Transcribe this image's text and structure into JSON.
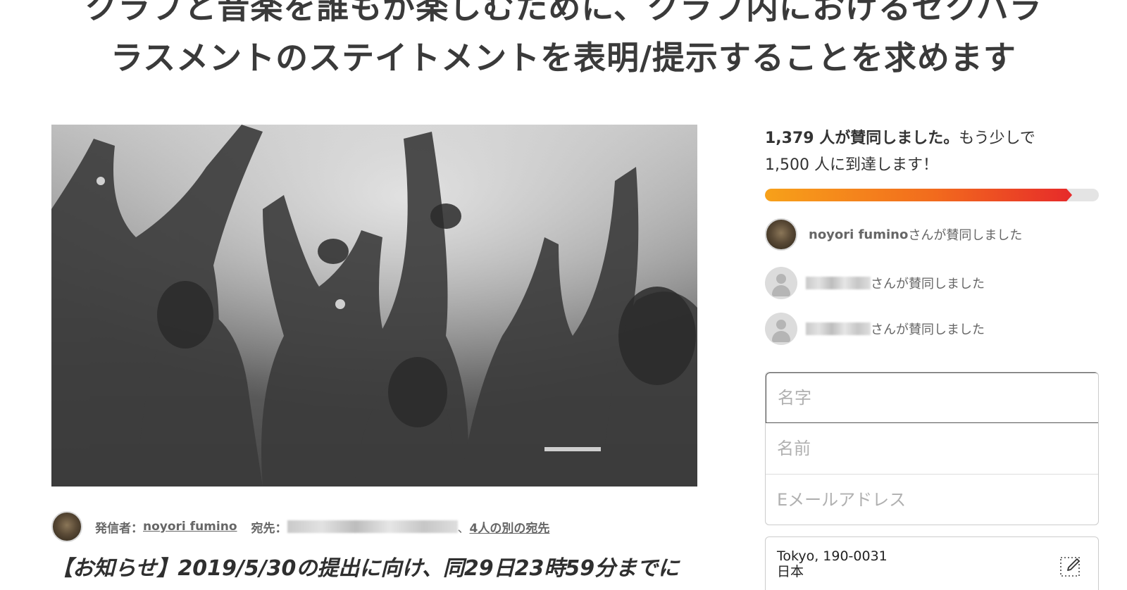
{
  "petition": {
    "title_line1": "クラブと音楽を誰もが楽しむために、クラブ内におけるセクハラ",
    "title_line2": "ラスメントのステイトメントを表明/提示することを求めます"
  },
  "author": {
    "sender_label": "発信者：",
    "sender_name": "noyori fumino",
    "recipient_label": "宛先：",
    "recipient_separator": "、",
    "other_recipients_link": "4人の別の宛先"
  },
  "announcement": "【お知らせ】2019/5/30の提出に向け、同29日23時59分までに",
  "progress": {
    "count_bold": "1,379 人が賛同しました。",
    "count_rest": "もう少しで",
    "goal_text": "1,500 人に到達します！",
    "fraction": 0.92,
    "colors": {
      "start": "#f7a11a",
      "end": "#e62a2a",
      "track": "#e4e4e4"
    }
  },
  "signers": [
    {
      "name": "noyori fumino",
      "suffix": "さんが賛同しました",
      "avatar": "photo"
    },
    {
      "name": "",
      "suffix": "さんが賛同しました",
      "avatar": "default-user-icon"
    },
    {
      "name": "",
      "suffix": "さんが賛同しました",
      "avatar": "default-user-icon"
    }
  ],
  "form": {
    "last_name_placeholder": "名字",
    "first_name_placeholder": "名前",
    "email_placeholder": "Eメールアドレス"
  },
  "location": {
    "line1": "Tokyo, 190-0031",
    "line2": "日本",
    "edit_icon": "pencil-edit-icon"
  }
}
